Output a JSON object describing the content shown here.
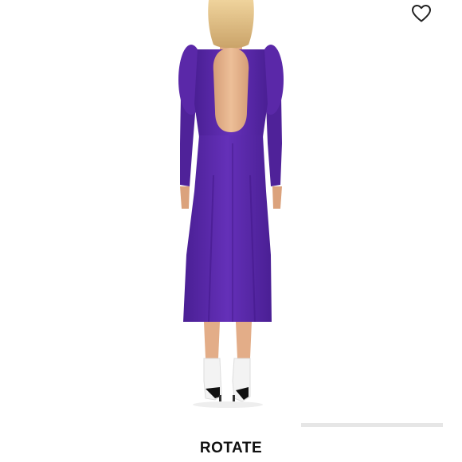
{
  "product": {
    "brand": "ROTATE",
    "dress_color": "#5b2aa8",
    "skin_tone": "#e6b28c",
    "hair_color": "#e2c38a"
  },
  "icons": {
    "like": "heart-outline-icon"
  },
  "carousel": {
    "track_color": "#e6e6e6"
  }
}
